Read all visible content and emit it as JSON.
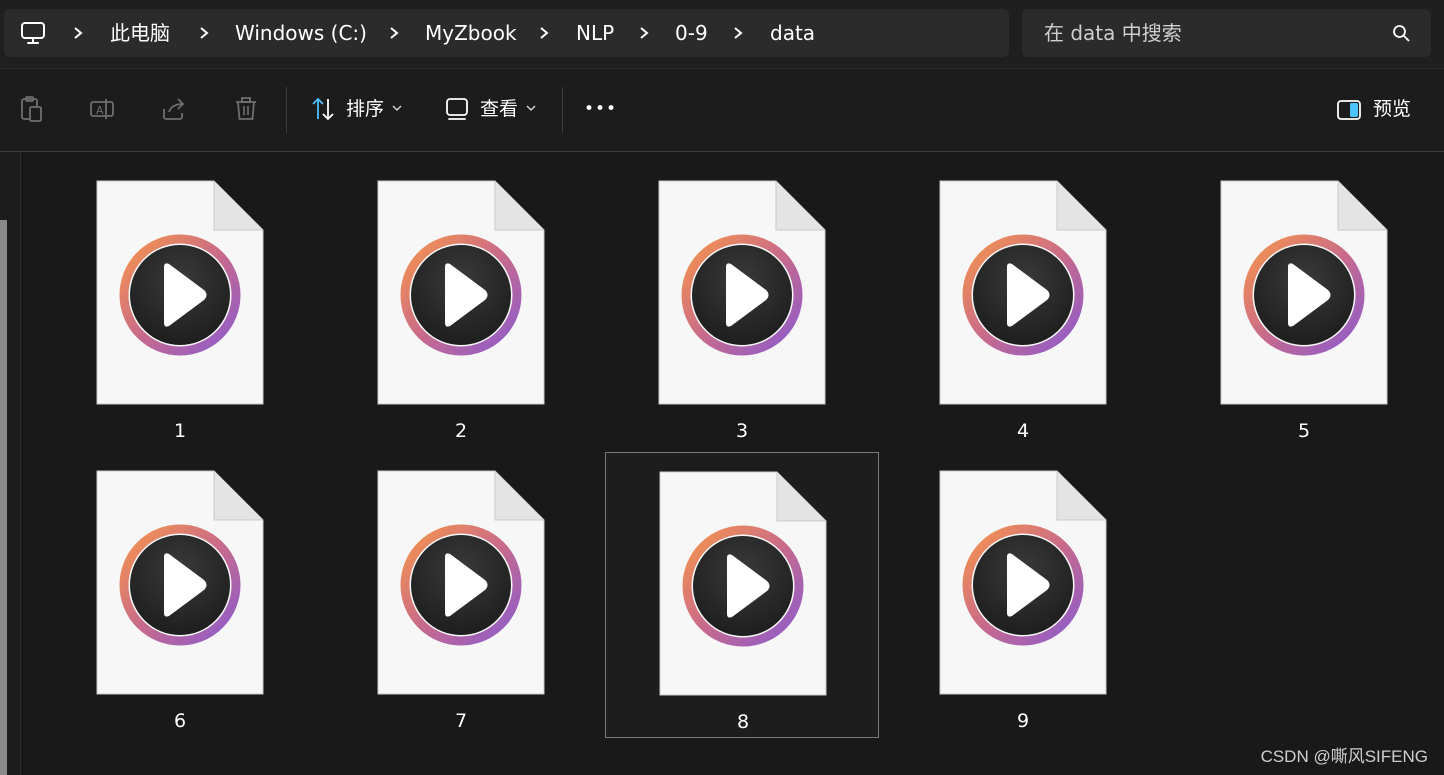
{
  "address_bar": {
    "crumbs": [
      "此电脑",
      "Windows (C:)",
      "MyZbook",
      "NLP",
      "0-9",
      "data"
    ]
  },
  "search": {
    "placeholder": "在 data 中搜索"
  },
  "toolbar": {
    "sort_label": "排序",
    "view_label": "查看",
    "more_label": "•••",
    "preview_label": "预览"
  },
  "files": [
    {
      "name": "1",
      "selected": false
    },
    {
      "name": "2",
      "selected": false
    },
    {
      "name": "3",
      "selected": false
    },
    {
      "name": "4",
      "selected": false
    },
    {
      "name": "5",
      "selected": false
    },
    {
      "name": "6",
      "selected": false
    },
    {
      "name": "7",
      "selected": false
    },
    {
      "name": "8",
      "selected": true
    },
    {
      "name": "9",
      "selected": false
    }
  ],
  "watermark": "CSDN @嘶风SIFENG",
  "colors": {
    "ring_start": "#f2914c",
    "ring_end": "#8e5fc9",
    "accent": "#4cc2ff"
  }
}
